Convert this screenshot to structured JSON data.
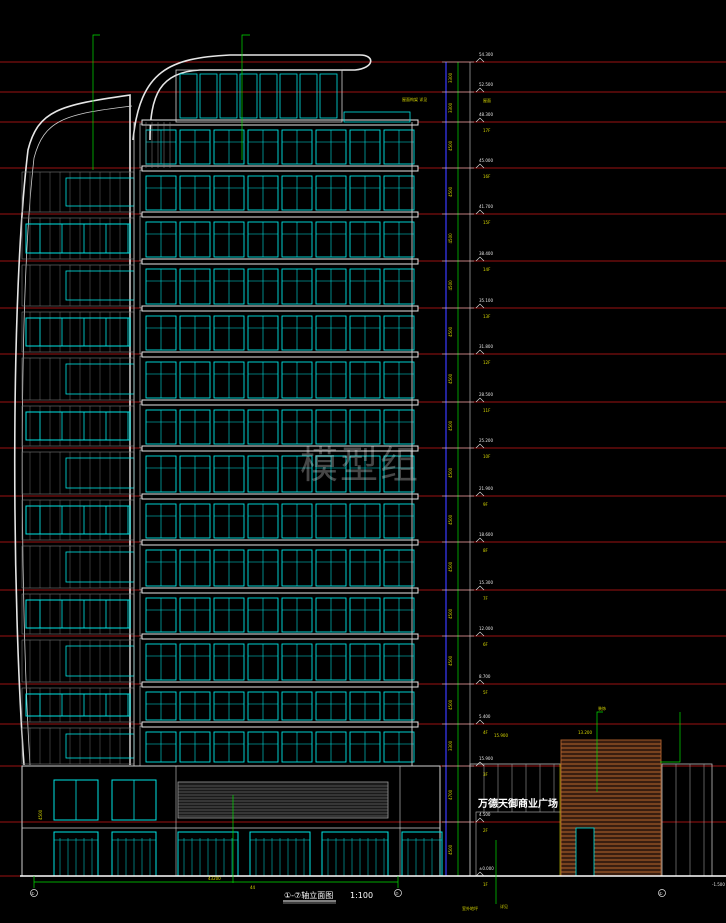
{
  "drawing": {
    "watermark": "模型组",
    "title": "①-⑦轴立面图",
    "scale": "1:100",
    "sign_text": "万德天御商业广场",
    "axis_left": "①",
    "axis_mid": "⑦",
    "axis_right": "①",
    "overall_width": "43200",
    "mid_dim": "44"
  },
  "levels": [
    {
      "floor": "",
      "elev": "54.300"
    },
    {
      "floor": "屋面",
      "elev": "52.500"
    },
    {
      "floor": "17F",
      "elev": "48.300"
    },
    {
      "floor": "16F",
      "elev": "45.000"
    },
    {
      "floor": "15F",
      "elev": "41.700"
    },
    {
      "floor": "14F",
      "elev": "38.400"
    },
    {
      "floor": "13F",
      "elev": "35.100"
    },
    {
      "floor": "12F",
      "elev": "31.800"
    },
    {
      "floor": "11F",
      "elev": "28.500"
    },
    {
      "floor": "10F",
      "elev": "25.200"
    },
    {
      "floor": "9F",
      "elev": "21.900"
    },
    {
      "floor": "8F",
      "elev": "18.600"
    },
    {
      "floor": "7F",
      "elev": "15.300"
    },
    {
      "floor": "6F",
      "elev": "12.000"
    },
    {
      "floor": "5F",
      "elev": "8.700"
    },
    {
      "floor": "4F",
      "elev": "5.400"
    },
    {
      "floor": "3F",
      "elev": "15.900"
    },
    {
      "floor": "2F",
      "elev": "4.500"
    },
    {
      "floor": "1F",
      "elev": "±0.000"
    }
  ],
  "dims": [
    "3300",
    "3300",
    "4500",
    "4500",
    "4500",
    "4500",
    "4500",
    "4500",
    "4500",
    "4500",
    "4500",
    "4500",
    "4500",
    "4500",
    "4500",
    "3300",
    "4700",
    "4500"
  ],
  "annotations": {
    "roof_note": "屋面构架 详见",
    "right_block_note": "装饰",
    "canopy_elev": "15.900",
    "right_elev": "13.200",
    "grade": "-1.500",
    "bottom_note1": "室外地坪",
    "bottom_note2": "详见",
    "left_label": "4500"
  }
}
